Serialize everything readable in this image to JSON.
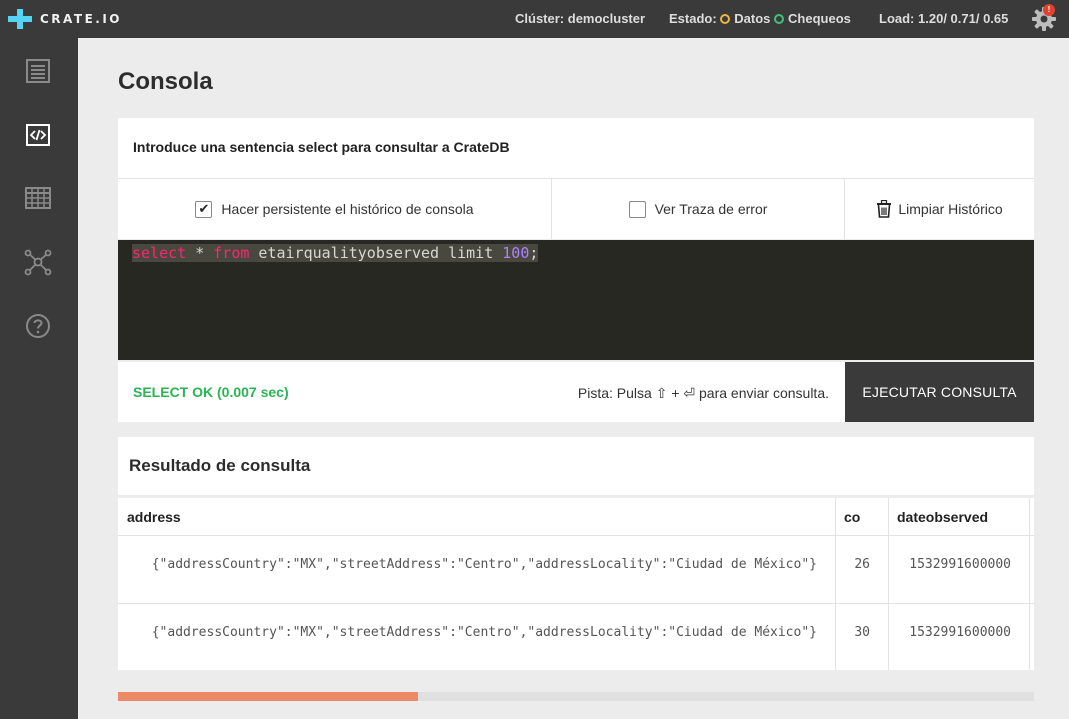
{
  "brand": {
    "name": "CRATE.IO"
  },
  "header": {
    "cluster_label": "Clúster:",
    "cluster_name": "democluster",
    "state_label": "Estado:",
    "data_label": "Datos",
    "checks_label": "Chequeos",
    "load_label": "Load:",
    "load_values": "1.20/ 0.71/ 0.65",
    "notification_count": "!"
  },
  "sidebar": {
    "items": [
      {
        "icon": "overview-icon"
      },
      {
        "icon": "console-icon"
      },
      {
        "icon": "tables-icon"
      },
      {
        "icon": "cluster-icon"
      },
      {
        "icon": "help-icon"
      }
    ]
  },
  "page": {
    "title": "Consola"
  },
  "console": {
    "prompt": "Introduce una sentencia select para consultar a CrateDB",
    "persist_history_label": "Hacer persistente el histórico de consola",
    "persist_history_checked": true,
    "error_trace_label": "Ver Traza de error",
    "error_trace_checked": false,
    "clear_history_label": "Limpiar Histórico",
    "query": {
      "kw_select": "select",
      "star": " * ",
      "kw_from": "from",
      "rest": " etairqualityobserved limit ",
      "number": "100",
      "end": ";"
    },
    "status": "SELECT OK (0.007 sec)",
    "hint": "Pista: Pulsa ⇧ + ⏎ para enviar consulta.",
    "run_label": "EJECUTAR CONSULTA"
  },
  "results": {
    "title": "Resultado de consulta",
    "columns": [
      "address",
      "co",
      "dateobserved"
    ],
    "rows": [
      [
        "{\"addressCountry\":\"MX\",\"streetAddress\":\"Centro\",\"addressLocality\":\"Ciudad de México\"}",
        "26",
        "1532991600000"
      ],
      [
        "{\"addressCountry\":\"MX\",\"streetAddress\":\"Centro\",\"addressLocality\":\"Ciudad de México\"}",
        "30",
        "1532991600000"
      ]
    ],
    "horizontal_scroll_position": 0.0
  },
  "colors": {
    "accent": "#55d4f5",
    "ok": "#2ab552",
    "warning": "#f2b43a",
    "scroll_thumb": "#ec8a66"
  }
}
